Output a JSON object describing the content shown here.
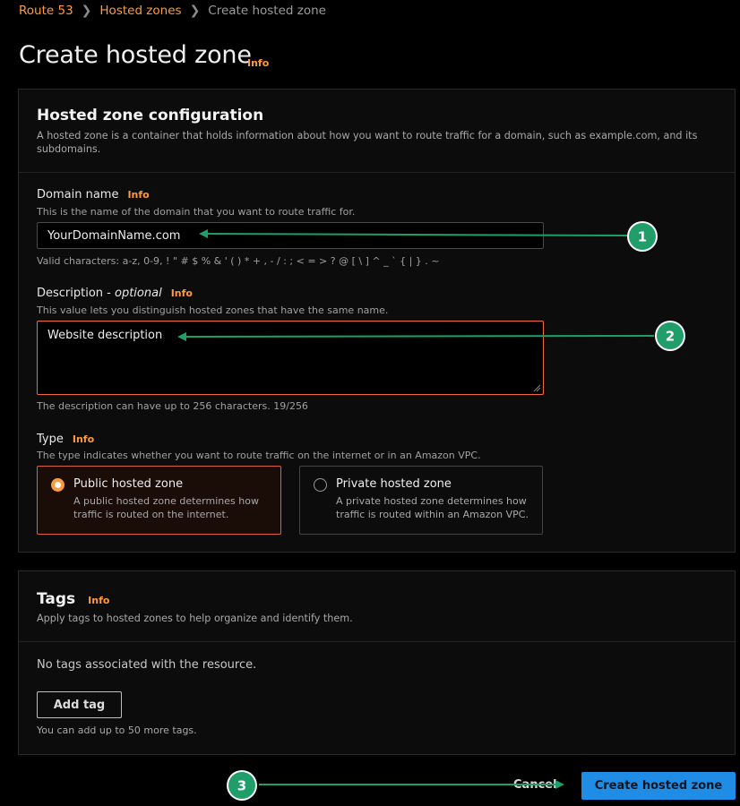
{
  "breadcrumb": {
    "items": [
      "Route 53",
      "Hosted zones"
    ],
    "current": "Create hosted zone"
  },
  "page": {
    "title": "Create hosted zone",
    "info": "Info"
  },
  "config": {
    "heading": "Hosted zone configuration",
    "description": "A hosted zone is a container that holds information about how you want to route traffic for a domain, such as example.com, and its subdomains.",
    "domain": {
      "label": "Domain name",
      "info": "Info",
      "hint": "This is the name of the domain that you want to route traffic for.",
      "value": "YourDomainName.com",
      "valid_chars": "Valid characters: a-z, 0-9, ! \" # $ % & ' ( ) * + , - / : ; < = > ? @ [ \\ ] ^ _ ` { | } . ~"
    },
    "desc_field": {
      "label": "Description - ",
      "optional": "optional",
      "info": "Info",
      "hint": "This value lets you distinguish hosted zones that have the same name.",
      "value": "Website description",
      "counter": "The description can have up to 256 characters. 19/256"
    },
    "type": {
      "label": "Type",
      "info": "Info",
      "hint": "The type indicates whether you want to route traffic on the internet or in an Amazon VPC.",
      "options": [
        {
          "title": "Public hosted zone",
          "desc": "A public hosted zone determines how traffic is routed on the internet.",
          "selected": true
        },
        {
          "title": "Private hosted zone",
          "desc": "A private hosted zone determines how traffic is routed within an Amazon VPC.",
          "selected": false
        }
      ]
    }
  },
  "tags": {
    "heading": "Tags",
    "info": "Info",
    "description": "Apply tags to hosted zones to help organize and identify them.",
    "empty": "No tags associated with the resource.",
    "add_label": "Add tag",
    "hint": "You can add up to 50 more tags."
  },
  "footer": {
    "cancel_label": "Cancel",
    "create_label": "Create hosted zone"
  },
  "annotations": {
    "markers": [
      "1",
      "2",
      "3"
    ],
    "color": "#1f9e6a"
  },
  "colors": {
    "accent": "#ff9a3c",
    "primary": "#1f8ce6",
    "error_border": "#f06a3c",
    "background": "#000000"
  }
}
